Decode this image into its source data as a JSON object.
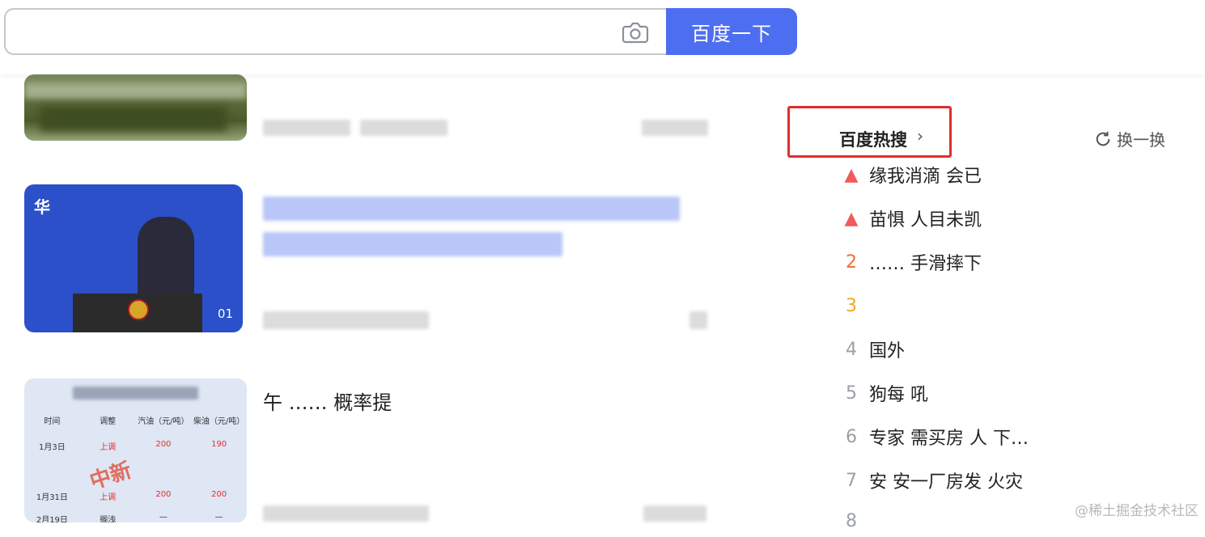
{
  "search": {
    "placeholder": "",
    "button_label": "百度一下"
  },
  "feed": [
    {
      "title": "",
      "meta": ""
    },
    {
      "title": "",
      "meta": "",
      "thumb_brand": "华",
      "thumb_duration": "01"
    },
    {
      "title": "午 …… 概率提",
      "meta": ""
    }
  ],
  "thumb3_table": {
    "headers": [
      "时间",
      "调整",
      "汽油（元/吨）",
      "柴油（元/吨）"
    ],
    "rows": [
      [
        "1月3日",
        "上调",
        "200",
        "190"
      ],
      [
        "",
        "",
        "",
        ""
      ],
      [
        "1月31日",
        "上调",
        "200",
        "200"
      ],
      [
        "2月19日",
        "搁浅",
        "—",
        "—"
      ]
    ],
    "logo": "中新"
  },
  "hot": {
    "title": "百度热搜",
    "refresh_label": "换一换",
    "items": [
      {
        "rank": "",
        "text": "缘我消滴 会已",
        "rank_style": "pin"
      },
      {
        "rank": "",
        "text": "苗惧 人目未凯",
        "rank_style": "pin"
      },
      {
        "rank": "2",
        "text": "…… 手滑摔下",
        "rank_style": "top"
      },
      {
        "rank": "3",
        "text": "",
        "rank_style": "sec"
      },
      {
        "rank": "4",
        "text": "国外",
        "rank_style": "normal"
      },
      {
        "rank": "5",
        "text": "狗每 吼",
        "rank_style": "normal"
      },
      {
        "rank": "6",
        "text": "专家 需买房 人 下…",
        "rank_style": "normal"
      },
      {
        "rank": "7",
        "text": "安 安一厂房发 火灾",
        "rank_style": "normal"
      },
      {
        "rank": "8",
        "text": "",
        "rank_style": "normal"
      }
    ]
  },
  "watermark": "@稀土掘金技术社区"
}
